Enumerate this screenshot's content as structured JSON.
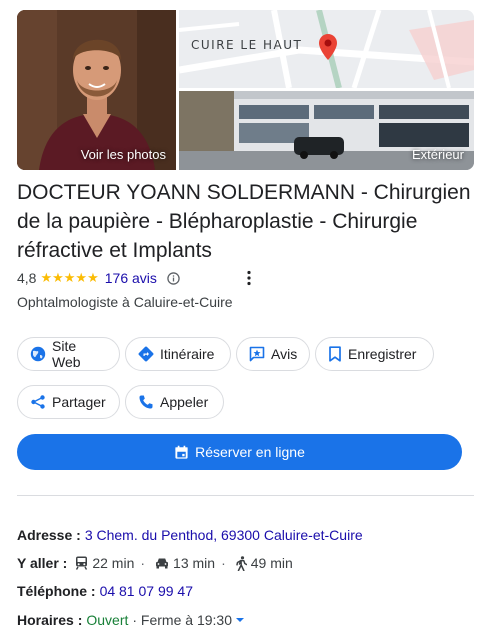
{
  "photos": {
    "main_caption": "Voir les photos",
    "map_label": "CUIRE LE HAUT",
    "exterior_caption": "Extérieur"
  },
  "business": {
    "title": "DOCTEUR YOANN SOLDERMANN - Chirurgien de la paupière - Blépharoplastie - Chirurgie réfractive et Implants",
    "rating": "4,8",
    "stars": "★★★★★",
    "rating_stars": 5,
    "reviews": "176 avis",
    "category": "Ophtalmologiste à Caluire-et-Cuire"
  },
  "actions": {
    "website": "Site Web",
    "directions": "Itinéraire",
    "reviews": "Avis",
    "save": "Enregistrer",
    "share": "Partager",
    "call": "Appeler",
    "book": "Réserver en ligne"
  },
  "info": {
    "address_label": "Adresse :",
    "address": "3 Chem. du Penthod, 69300 Caluire-et-Cuire",
    "directions_label": "Y aller :",
    "transit_time": "22 min",
    "car_time": "13 min",
    "walk_time": "49 min",
    "phone_label": "Téléphone :",
    "phone": "04 81 07 99 47",
    "hours_label": "Horaires :",
    "hours_status": "Ouvert",
    "hours_close": "· Ferme à 19:30"
  },
  "colors": {
    "accent": "#1a73e8",
    "star": "#fbbc04",
    "open": "#188038",
    "link": "#1a0dab",
    "pin": "#ea4335"
  }
}
